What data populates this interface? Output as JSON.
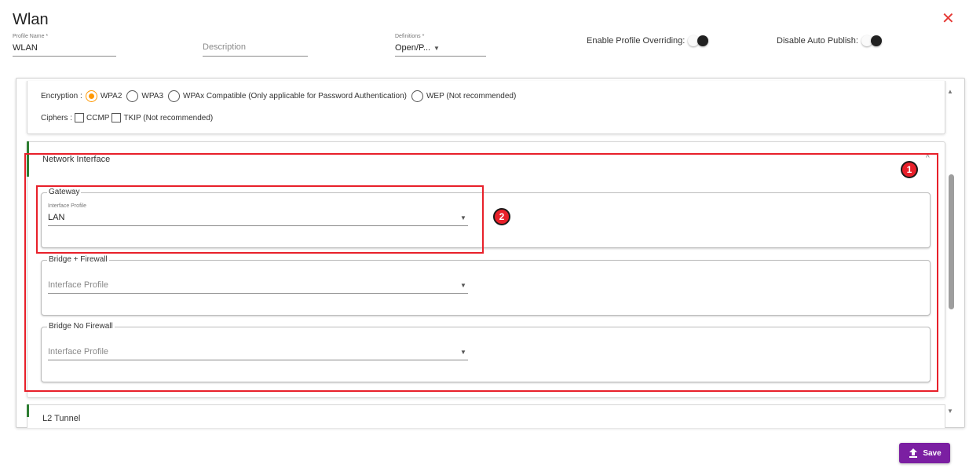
{
  "header": {
    "title": "Wlan",
    "close_glyph": "✕",
    "profile_name": {
      "label": "Profile Name *",
      "value": "WLAN"
    },
    "description": {
      "placeholder": "Description"
    },
    "definitions": {
      "label": "Definitions *",
      "value": "Open/P..."
    },
    "enable_override": {
      "label": "Enable Profile Overriding:",
      "enabled": false
    },
    "disable_auto_publish": {
      "label": "Disable Auto Publish:",
      "enabled": false
    }
  },
  "encryption": {
    "label": "Encryption :",
    "options": [
      {
        "label": "WPA2",
        "selected": true
      },
      {
        "label": "WPA3",
        "selected": false
      },
      {
        "label": "WPAx Compatible (Only applicable for Password Authentication)",
        "selected": false
      },
      {
        "label": "WEP (Not recommended)",
        "selected": false
      }
    ],
    "ciphers_label": "Ciphers :",
    "ciphers": [
      {
        "label": "CCMP",
        "checked": false
      },
      {
        "label": "TKIP (Not recommended)",
        "checked": false
      }
    ]
  },
  "network_interface": {
    "title": "Network Interface",
    "gateway": {
      "legend": "Gateway",
      "field_label": "Interface Profile",
      "value": "LAN"
    },
    "bridge_firewall": {
      "legend": "Bridge + Firewall",
      "placeholder": "Interface Profile"
    },
    "bridge_no_firewall": {
      "legend": "Bridge No Firewall",
      "placeholder": "Interface Profile"
    }
  },
  "l2_tunnel": {
    "title": "L2 Tunnel"
  },
  "annotations": {
    "badge_1": "1",
    "badge_2": "2"
  },
  "save_button": {
    "label": "Save",
    "icon": "upload-icon",
    "color": "#7b1fa2"
  },
  "colors": {
    "accent": "#ff9800",
    "annotation": "#e8202a",
    "section_bar": "#2e7d32",
    "close": "#e53935"
  }
}
